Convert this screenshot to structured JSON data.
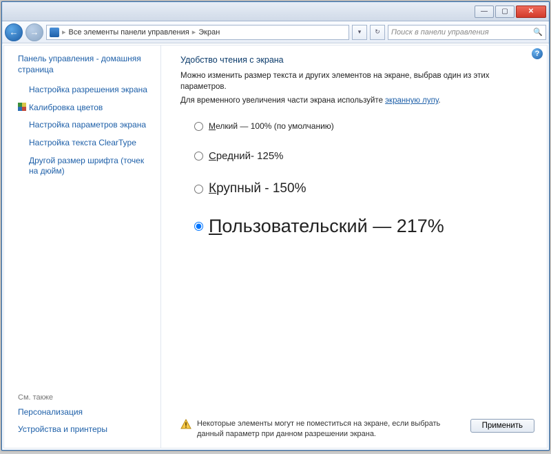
{
  "breadcrumb": {
    "root": "Все элементы панели управления",
    "current": "Экран"
  },
  "search": {
    "placeholder": "Поиск в панели управления"
  },
  "sidebar": {
    "home": "Панель управления - домашняя страница",
    "links": [
      "Настройка разрешения экрана",
      "Калибровка цветов",
      "Настройка параметров экрана",
      "Настройка текста ClearType",
      "Другой размер шрифта (точек на дюйм)"
    ],
    "see_also_label": "См. также",
    "see_also": [
      "Персонализация",
      "Устройства и принтеры"
    ]
  },
  "main": {
    "title": "Удобство чтения с экрана",
    "desc1": "Можно изменить размер текста и других элементов на экране, выбрав один из этих параметров.",
    "desc2": "Для временного увеличения части экрана используйте ",
    "desc_link": "экранную лупу",
    "options": [
      {
        "u": "М",
        "rest": "елкий — 100% (по умолчанию)"
      },
      {
        "u": "С",
        "rest": "редний- 125%"
      },
      {
        "u": "К",
        "rest": "рупный - 150%"
      },
      {
        "u": "П",
        "rest": "ользовательский — 217%"
      }
    ],
    "warning": "Некоторые элементы могут не поместиться на экране, если выбрать данный параметр при данном разрешении экрана.",
    "apply": "Применить"
  }
}
